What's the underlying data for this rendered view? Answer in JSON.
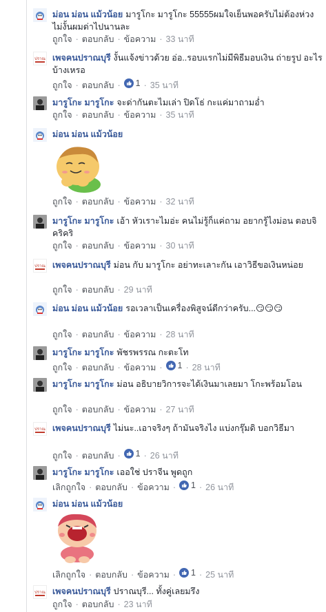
{
  "actions": {
    "like": "ถูกใจ",
    "unlike": "เลิกถูกใจ",
    "reply": "ตอบกลับ",
    "message": "ข้อความ",
    "sep": "·"
  },
  "comments": [
    {
      "author": "ม่อน ม่อน แม้วน้อย",
      "text": "มารูโกะ มารูโกะ 55555ผมใจเย็นพอครับไม่ต้องห่วงไม่งั้นผมด่าไปนานละ",
      "like_label": "ถูกใจ",
      "likes": "",
      "time": "33 นาที"
    },
    {
      "author": "เพจคนปราณบุรี",
      "text": "งั้นแจ้งข่าวด้วย อ่อ..รอบแรกไม่มีพิธีมอบเงิน ถ่ายรูป อะไรบ้างเหรอ",
      "like_label": "ถูกใจ",
      "likes": "1",
      "time": "35 นาที"
    },
    {
      "author": "มารูโกะ มารูโกะ",
      "text": "จะด่ากันตะไมเล่า ปิดโธ่ กะแค่มาถามอ่ำ",
      "like_label": "ถูกใจ",
      "likes": "",
      "time": "35 นาที"
    },
    {
      "author": "ม่อน ม่อน แม้วน้อย",
      "text": "",
      "like_label": "ถูกใจ",
      "likes": "",
      "time": "32 นาที"
    },
    {
      "author": "มารูโกะ มารูโกะ",
      "text": "เอ้า หัวเราะไมอ่ะ คนไม่รู้ก็แค่ถาม อยากรู้ไงม่อน ตอบจิ คริคริ",
      "like_label": "ถูกใจ",
      "likes": "",
      "time": "30 นาที"
    },
    {
      "author": "เพจคนปราณบุรี",
      "text": "ม่อน กับ มารูโกะ อย่าทะเลาะกัน เอาวิธีขอเงินหน่อย",
      "like_label": "ถูกใจ",
      "likes": "",
      "time": "29 นาที"
    },
    {
      "author": "ม่อน ม่อน แม้วน้อย",
      "text": "รอเวลาเป็นเครื่องพิสูจน์ดีกว่าครับ...😏😏😏",
      "like_label": "ถูกใจ",
      "likes": "",
      "time": "28 นาที"
    },
    {
      "author": "มารูโกะ มารูโกะ",
      "text": "พัชรพรรณ กะตะโท",
      "like_label": "ถูกใจ",
      "likes": "1",
      "time": "28 นาที"
    },
    {
      "author": "มารูโกะ มารูโกะ",
      "text": "ม่อน อธิบายวิการจะได้เงินมาเลยมา โกะพร้อมโอน",
      "like_label": "ถูกใจ",
      "likes": "",
      "time": "27 นาที"
    },
    {
      "author": "เพจคนปราณบุรี",
      "text": "ไม่นะ..เอาจริงๆ ถ้ามันจริงไง แบ่งกรุ๊มดิ บอกวิธีมา",
      "like_label": "ถูกใจ",
      "likes": "1",
      "time": "26 นาที"
    },
    {
      "author": "มารูโกะ มารูโกะ",
      "text": "เออใช่ ปราจีน พูดถูก",
      "like_label": "เลิกถูกใจ",
      "likes": "1",
      "time": "26 นาที"
    },
    {
      "author": "ม่อน ม่อน แม้วน้อย",
      "text": "",
      "like_label": "เลิกถูกใจ",
      "likes": "1",
      "time": "25 นาที"
    },
    {
      "author": "เพจคนปราณบุรี",
      "text": "ปราณบุรี... ทั้งคู่เลยมรึง",
      "like_label": "ถูกใจ",
      "likes": "",
      "time": "23 นาที"
    }
  ],
  "colors": {
    "author": "#385898",
    "meta": "#90949c",
    "like_blue": "#4267b2"
  },
  "avatars": {
    "mon": "cat-avatar",
    "page": "page-logo-avatar",
    "maruko": "person-avatar"
  }
}
